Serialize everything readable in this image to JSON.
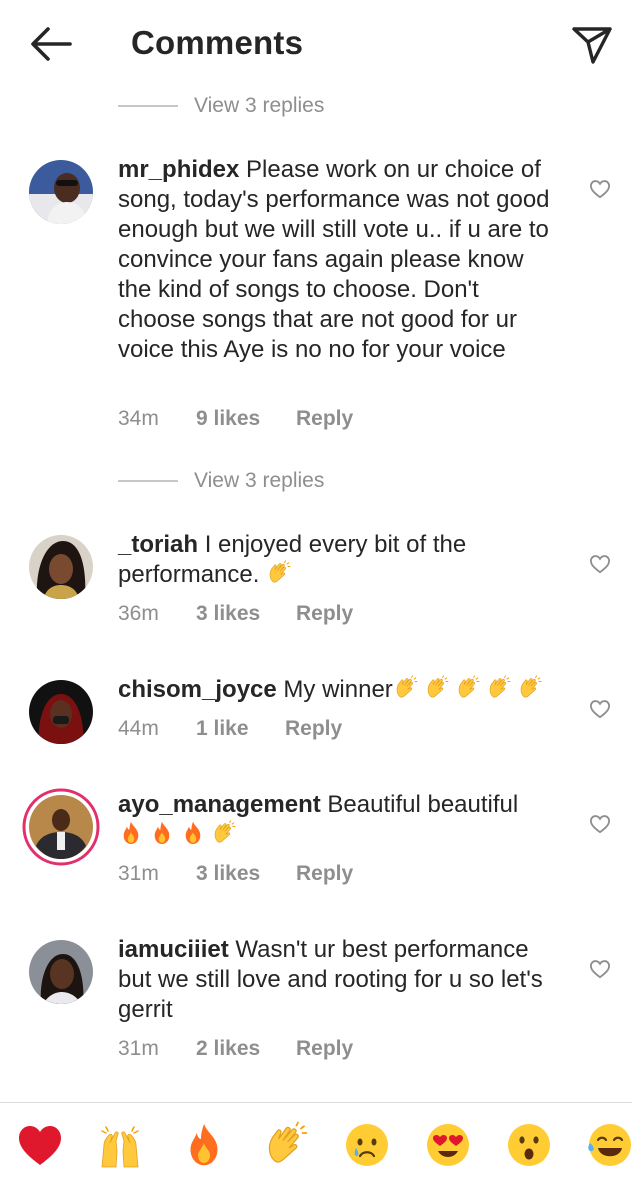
{
  "header": {
    "title": "Comments",
    "back_icon": "arrow-left-icon",
    "send_icon": "paper-plane-icon"
  },
  "replies_a": "View 3 replies",
  "replies_b": "View 3 replies",
  "comments": [
    {
      "username": "mr_phidex",
      "text": "Please work on ur choice of song, today's performance was not good enough but we will still vote u.. if u are to convince your fans again please know the kind of songs to choose. Don't choose songs that are not good for ur voice this Aye is no no for your voice",
      "time": "34m",
      "likes": "9 likes",
      "reply": "Reply"
    },
    {
      "username": "_toriah",
      "text": "I enjoyed every bit of the performance.",
      "time": "36m",
      "likes": "3 likes",
      "reply": "Reply"
    },
    {
      "username": "chisom_joyce",
      "text": "My winner",
      "time": "44m",
      "likes": "1 like",
      "reply": "Reply"
    },
    {
      "username": "ayo_management",
      "text": "Beautiful beautiful",
      "time": "31m",
      "likes": "3 likes",
      "reply": "Reply"
    },
    {
      "username": "iamuciiiet",
      "text": "Wasn't ur best performance but we still love and rooting for u so let's gerrit",
      "time": "31m",
      "likes": "2 likes",
      "reply": "Reply"
    }
  ],
  "emoji_bar": [
    "red-heart",
    "raising-hands",
    "fire",
    "clapping-hands",
    "crying-face",
    "heart-eyes-face",
    "astonished-face",
    "tears-of-joy-face"
  ],
  "colors": {
    "text": "#262626",
    "muted": "#8e8e8e",
    "divider": "#dbdbdb",
    "story_ring": "#e1306c"
  }
}
